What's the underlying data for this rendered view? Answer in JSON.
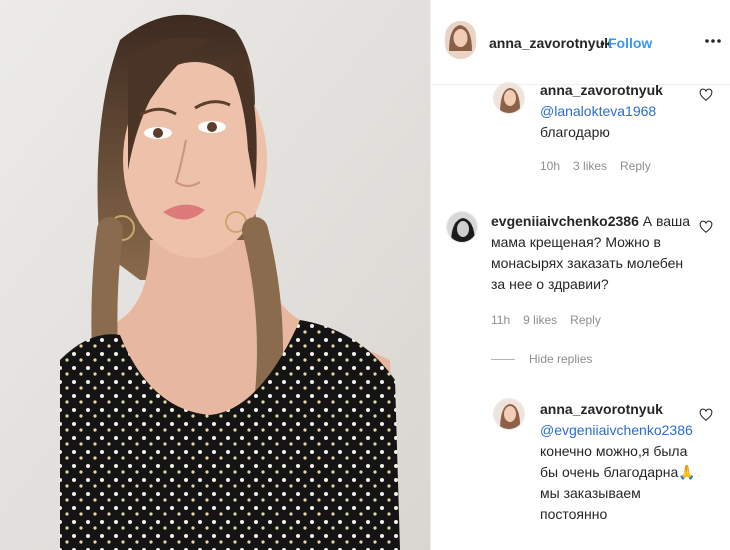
{
  "post": {
    "author": "anna_zavorotnyuk",
    "separator": "•",
    "follow_label": "Follow"
  },
  "comments": [
    {
      "username": "anna_zavorotnyuk",
      "mention": "@lanalokteva1968",
      "lines": [
        "благодарю"
      ],
      "time": "10h",
      "likes": "3 likes",
      "reply_label": "Reply"
    },
    {
      "username": "evgeniiaivchenko2386",
      "lines": [
        "А ваша",
        "мама крещеная? Можно в",
        "монасырях заказать молебен",
        "за нее о здравии?"
      ],
      "time": "11h",
      "likes": "9 likes",
      "reply_label": "Reply"
    },
    {
      "username": "anna_zavorotnyuk",
      "mention": "@evgeniiaivchenko2386",
      "lines": [
        "конечно можно,я была",
        "бы очень благодарна🙏",
        "мы заказываем",
        "постоянно"
      ]
    }
  ],
  "hide_replies_label": "Hide replies",
  "icons": {
    "more": "more-options-icon",
    "like": "heart-outline-icon"
  },
  "colors": {
    "link_blue": "#3897f0",
    "mention_blue": "#2a6dcc",
    "secondary_text": "#8e8e8e",
    "primary_text": "#262626"
  }
}
